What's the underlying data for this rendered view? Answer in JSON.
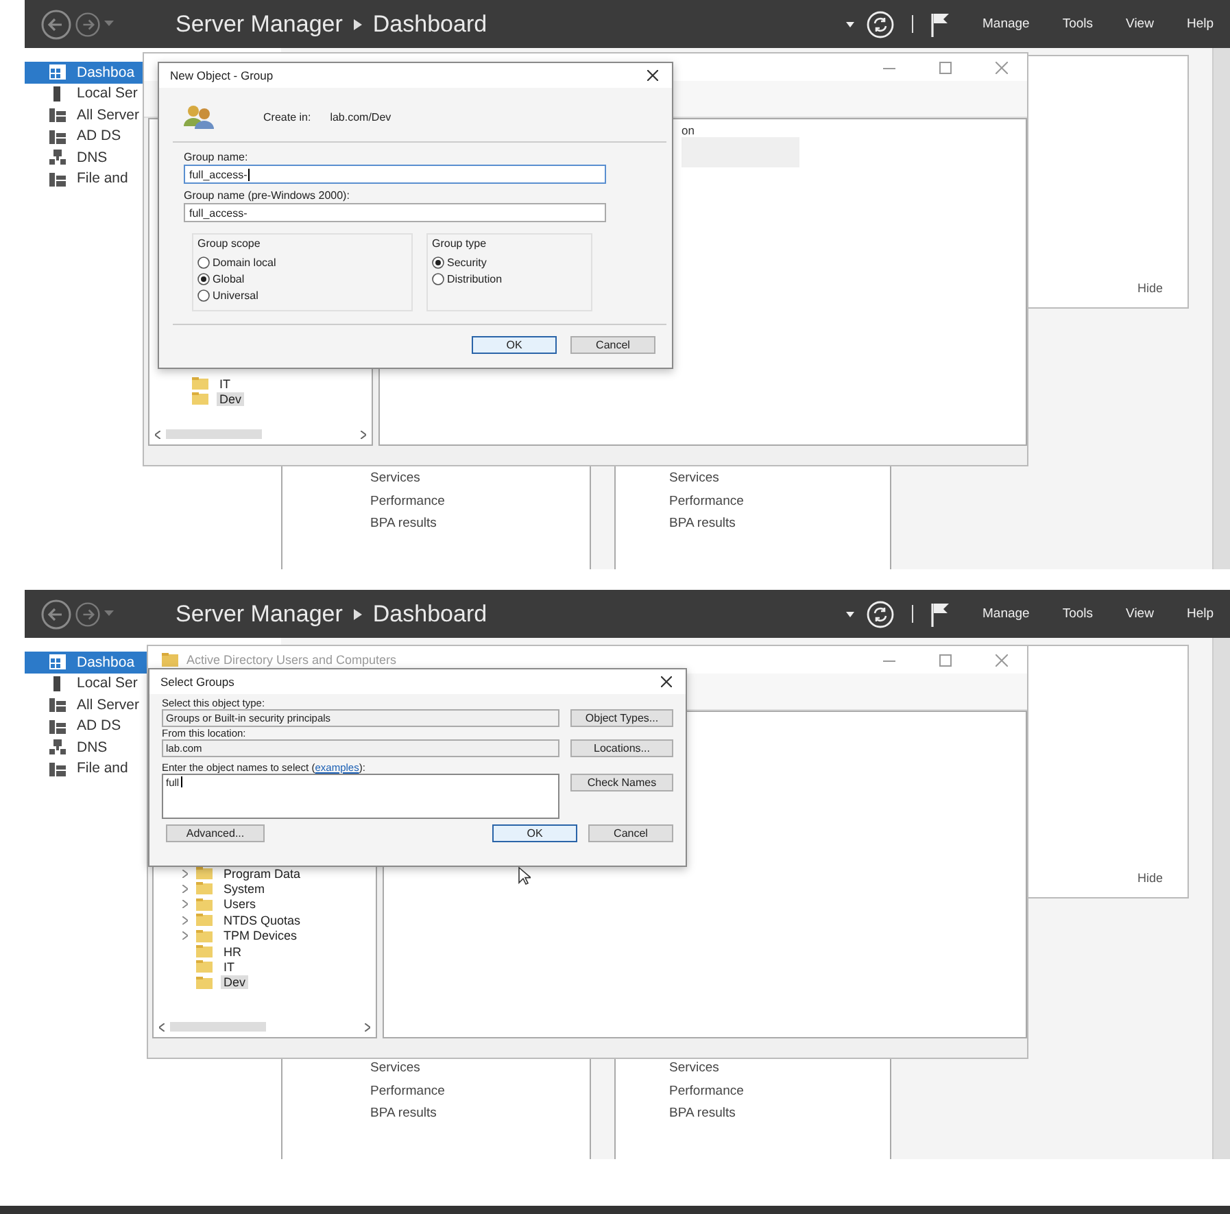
{
  "panels": [
    {
      "header": {
        "title": "Server Manager",
        "page": "Dashboard",
        "menu": [
          "Manage",
          "Tools",
          "View",
          "Help"
        ]
      },
      "sidebar": {
        "items": [
          {
            "label": "Dashboa",
            "selected": true
          },
          {
            "label": "Local Ser",
            "selected": false
          },
          {
            "label": "All Server",
            "selected": false
          },
          {
            "label": "AD DS",
            "selected": false
          },
          {
            "label": "DNS",
            "selected": false
          },
          {
            "label": "File and",
            "selected": false
          }
        ]
      },
      "hide_label": "Hide",
      "tiles": [
        {
          "items": [
            "Services",
            "Performance",
            "BPA results"
          ]
        },
        {
          "items": [
            "Services",
            "Performance",
            "BPA results"
          ]
        }
      ],
      "aduc": {
        "list_header": "on",
        "tree": [
          {
            "label": "IT",
            "expandable": false,
            "selected": false
          },
          {
            "label": "Dev",
            "expandable": false,
            "selected": true
          }
        ]
      },
      "dialog": {
        "kind": "new_group",
        "title": "New Object - Group",
        "create_in_label": "Create in:",
        "create_in": "lab.com/Dev",
        "fields": [
          {
            "label": "Group name:",
            "value": "full_access-",
            "focused": true
          },
          {
            "label": "Group name (pre-Windows 2000):",
            "value": "full_access-",
            "focused": false
          }
        ],
        "groups": [
          {
            "title": "Group scope",
            "options": [
              {
                "label": "Domain local",
                "selected": false
              },
              {
                "label": "Global",
                "selected": true
              },
              {
                "label": "Universal",
                "selected": false
              }
            ]
          },
          {
            "title": "Group type",
            "options": [
              {
                "label": "Security",
                "selected": true
              },
              {
                "label": "Distribution",
                "selected": false
              }
            ]
          }
        ],
        "buttons": [
          {
            "label": "OK",
            "default": true
          },
          {
            "label": "Cancel",
            "default": false
          }
        ]
      }
    },
    {
      "header": {
        "title": "Server Manager",
        "page": "Dashboard",
        "menu": [
          "Manage",
          "Tools",
          "View",
          "Help"
        ]
      },
      "sidebar": {
        "items": [
          {
            "label": "Dashboa",
            "selected": true
          },
          {
            "label": "Local Ser",
            "selected": false
          },
          {
            "label": "All Server",
            "selected": false
          },
          {
            "label": "AD DS",
            "selected": false
          },
          {
            "label": "DNS",
            "selected": false
          },
          {
            "label": "File and",
            "selected": false
          }
        ]
      },
      "hide_label": "Hide",
      "tiles": [
        {
          "items": [
            "Services",
            "Performance",
            "BPA results"
          ]
        },
        {
          "items": [
            "Services",
            "Performance",
            "BPA results"
          ]
        }
      ],
      "aduc": {
        "title": "Active Directory Users and Computers",
        "tree": [
          {
            "label": "Program Data",
            "expandable": true,
            "selected": false
          },
          {
            "label": "System",
            "expandable": true,
            "selected": false
          },
          {
            "label": "Users",
            "expandable": true,
            "selected": false
          },
          {
            "label": "NTDS Quotas",
            "expandable": true,
            "selected": false
          },
          {
            "label": "TPM Devices",
            "expandable": true,
            "selected": false
          },
          {
            "label": "HR",
            "expandable": false,
            "selected": false
          },
          {
            "label": "IT",
            "expandable": false,
            "selected": false
          },
          {
            "label": "Dev",
            "expandable": false,
            "selected": true
          }
        ]
      },
      "dialog": {
        "kind": "select_groups",
        "title": "Select Groups",
        "rows": [
          {
            "label": "Select this object type:",
            "value": "Groups or Built-in security principals",
            "button": "Object Types..."
          },
          {
            "label": "From this location:",
            "value": "lab.com",
            "button": "Locations..."
          }
        ],
        "names_before": "Enter the object names to select (",
        "names_link": "examples",
        "names_after": "):",
        "names_value": "full",
        "check_button": "Check Names",
        "advanced_button": "Advanced...",
        "buttons": [
          {
            "label": "OK",
            "default": true
          },
          {
            "label": "Cancel",
            "default": false
          }
        ]
      }
    }
  ]
}
